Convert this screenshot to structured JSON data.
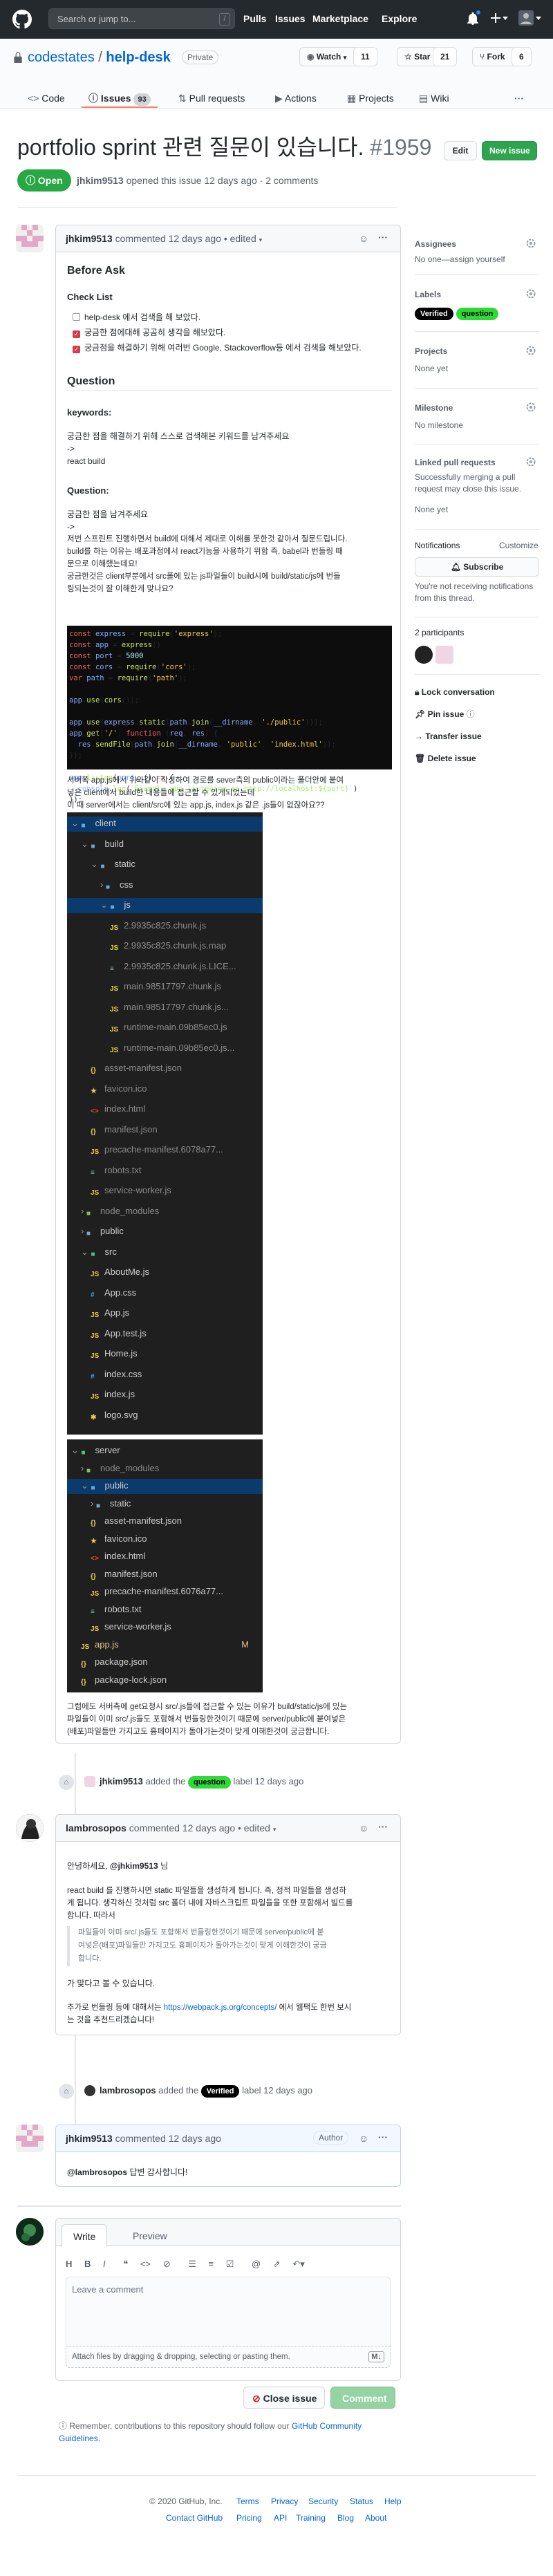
{
  "header": {
    "search_placeholder": "Search or jump to...",
    "slash_key": "/",
    "nav": [
      "Pulls",
      "Issues",
      "Marketplace",
      "Explore"
    ]
  },
  "repo": {
    "owner": "codestates",
    "separator": "/",
    "name": "help-desk",
    "visibility": "Private",
    "watch_label": "Watch",
    "watch_count": "11",
    "star_label": "Star",
    "star_count": "21",
    "fork_label": "Fork",
    "fork_count": "6",
    "tabs": [
      {
        "label": "Code"
      },
      {
        "label": "Issues",
        "count": "93"
      },
      {
        "label": "Pull requests"
      },
      {
        "label": "Actions"
      },
      {
        "label": "Projects"
      },
      {
        "label": "Wiki"
      }
    ]
  },
  "issue": {
    "title": "portfolio sprint 관련 질문이 있습니다.",
    "number": "#1959",
    "edit_label": "Edit",
    "new_issue_label": "New issue",
    "state": "Open",
    "meta_user": "jhkim9513",
    "meta_rest": "opened this issue 12 days ago · 2 comments"
  },
  "comment1": {
    "author": "jhkim9513",
    "meta": "commented 12 days ago • edited",
    "h_before_ask": "Before Ask",
    "h_checklist": "Check List",
    "checks": [
      {
        "text": "help-desk 에서 검색을 해 보았다.",
        "checked": false
      },
      {
        "text": "궁금한 점에대해 공곰히 생각을 해보았다.",
        "checked": true
      },
      {
        "text": "궁금점을 해결하기 위해 여러번 Google, Stackoverflow등 에서 검색을 해보았다.",
        "checked": true
      }
    ],
    "h_question": "Question",
    "keywords_label": "keywords:",
    "keywords_desc": "궁금한 점을 해결하기 위해 스스로 검색해본 키워드를 남겨주세요",
    "arrow1": "->",
    "keywords_value": "react build",
    "question_label": "Question:",
    "question_desc": "궁금한 점을 남겨주세요",
    "arrow2": "->",
    "q_p1_l1": "저번 스프린트 진행하면서 build에 대해서 제대로 이해를 못한것 같아서 질문드립니다.",
    "q_p1_l2": "build를 하는 이유는 배포과정에서 react기능을 사용하기 위함 즉, babel과 번들링 때",
    "q_p1_l3": "문으로 이해했는데요!",
    "q_p1_l4": "궁금한것은 client부분에서 src폴에 있는 js파일들이 build시에 build/static/js에 번들",
    "q_p1_l5": "링되는것이 잘 이해한게 맞나요?",
    "code": [
      "const express = require('express');",
      "const app = express()",
      "const port = 5000",
      "const cors = require('cors');",
      "var path = require('path');",
      "",
      "app.use(cors());",
      "",
      "app.use(express.static(path.join(__dirname, './public')));",
      "app.get('/', function (req, res) {",
      "  res.sendFile(path.join(__dirname, 'public', 'index.html'));",
      "});",
      "",
      "app.listen(port, () => {",
      "  console.log(`Example app listening at http://localhost:${port}`)",
      "});"
    ],
    "q_p2_l1": "서버쪽 app.js에서 위와같이 작성하여 경로를 sever측의 public이라는 폴더안에 붙여",
    "q_p2_l2": "넣은 client에서 build한 내용들에 접근할 수 있게되었는데",
    "q_p2_l3": "이 때 server에서는 client/src에 있는 app.js, index.js 같은 .js들이 없잖아요??",
    "tree1": [
      {
        "name": "client",
        "type": "folder-open",
        "depth": 0,
        "sel": true
      },
      {
        "name": "build",
        "type": "folder-open",
        "depth": 1
      },
      {
        "name": "static",
        "type": "folder-open",
        "depth": 2
      },
      {
        "name": "css",
        "type": "folder",
        "depth": 3
      },
      {
        "name": "js",
        "type": "folder-open",
        "depth": 3,
        "sel": true
      },
      {
        "name": "2.9935c825.chunk.js",
        "type": "js",
        "depth": 4,
        "dim": true
      },
      {
        "name": "2.9935c825.chunk.js.map",
        "type": "js",
        "depth": 4,
        "dim": true
      },
      {
        "name": "2.9935c825.chunk.js.LICE...",
        "type": "txt",
        "depth": 4,
        "dim": true
      },
      {
        "name": "main.98517797.chunk.js",
        "type": "js",
        "depth": 4,
        "dim": true
      },
      {
        "name": "main.98517797.chunk.js...",
        "type": "js",
        "depth": 4,
        "dim": true
      },
      {
        "name": "runtime-main.09b85ec0.js",
        "type": "js",
        "depth": 4,
        "dim": true
      },
      {
        "name": "runtime-main.09b85ec0.js...",
        "type": "js",
        "depth": 4,
        "dim": true
      },
      {
        "name": "asset-manifest.json",
        "type": "json",
        "depth": 2,
        "dim": true
      },
      {
        "name": "favicon.ico",
        "type": "star",
        "depth": 2,
        "dim": true
      },
      {
        "name": "index.html",
        "type": "html",
        "depth": 2,
        "dim": true
      },
      {
        "name": "manifest.json",
        "type": "json",
        "depth": 2,
        "dim": true
      },
      {
        "name": "precache-manifest.6078a77...",
        "type": "js",
        "depth": 2,
        "dim": true
      },
      {
        "name": "robots.txt",
        "type": "txt",
        "depth": 2,
        "dim": true
      },
      {
        "name": "service-worker.js",
        "type": "js",
        "depth": 2,
        "dim": true
      },
      {
        "name": "node_modules",
        "type": "folder",
        "depth": 1,
        "dim": true
      },
      {
        "name": "public",
        "type": "folder",
        "depth": 1
      },
      {
        "name": "src",
        "type": "folder-open",
        "depth": 1
      },
      {
        "name": "AboutMe.js",
        "type": "js",
        "depth": 2
      },
      {
        "name": "App.css",
        "type": "css",
        "depth": 2
      },
      {
        "name": "App.js",
        "type": "js",
        "depth": 2
      },
      {
        "name": "App.test.js",
        "type": "js",
        "depth": 2
      },
      {
        "name": "Home.js",
        "type": "js",
        "depth": 2
      },
      {
        "name": "index.css",
        "type": "css",
        "depth": 2
      },
      {
        "name": "index.js",
        "type": "js",
        "depth": 2
      },
      {
        "name": "logo.svg",
        "type": "svg",
        "depth": 2
      }
    ],
    "tree2": [
      {
        "name": "server",
        "type": "folder-open",
        "depth": 0
      },
      {
        "name": "node_modules",
        "type": "folder",
        "depth": 1,
        "dim": true
      },
      {
        "name": "public",
        "type": "folder-open",
        "depth": 1,
        "sel": true
      },
      {
        "name": "static",
        "type": "folder",
        "depth": 2
      },
      {
        "name": "asset-manifest.json",
        "type": "json",
        "depth": 2
      },
      {
        "name": "favicon.ico",
        "type": "star",
        "depth": 2
      },
      {
        "name": "index.html",
        "type": "html",
        "depth": 2
      },
      {
        "name": "manifest.json",
        "type": "json",
        "depth": 2
      },
      {
        "name": "precache-manifest.6076a77...",
        "type": "js",
        "depth": 2
      },
      {
        "name": "robots.txt",
        "type": "txt",
        "depth": 2
      },
      {
        "name": "service-worker.js",
        "type": "js",
        "depth": 2
      },
      {
        "name": "app.js",
        "type": "js",
        "depth": 1,
        "yellow": true,
        "badge": "M"
      },
      {
        "name": "package.json",
        "type": "json",
        "depth": 1
      },
      {
        "name": "package-lock.json",
        "type": "json",
        "depth": 1
      }
    ],
    "q_p3_l1": "그럼에도 서버측에 get요청시 src/.js들에 접근할 수 있는 이유가 build/static/js에 있는",
    "q_p3_l2": "파일들이 이미 src/.js들도 포함해서 번들링한것이기 때문에 server/public에 붙여넣은",
    "q_p3_l3": "(배포)파일들만 가지고도 흉페이지가 돌아가는것이 맞게 이해한것이 궁금합니다."
  },
  "event1": {
    "user": "jhkim9513",
    "pre": "added the",
    "label": "question",
    "post": "label 12 days ago"
  },
  "comment2": {
    "author": "lambrosopos",
    "meta": "commented 12 days ago • edited",
    "greet_pre": "안녕하세요, ",
    "greet_mention": "@jhkim9513",
    "greet_post": " 님",
    "p1_l1": "react build 를 진행하시면 static 파일들을 생성하게 됩니다. 즉, 정적 파일들을 생성하",
    "p1_l2": "게 됩니다. 생각하신 것처럼 src 폴더 내에 자바스크립트 파일들을 또한 포함해서 빌드를",
    "p1_l3": "합니다. 따라서",
    "quote_l1": "파일들이 이미 src/.js들도 포함해서 번들링한것이기 때문에 server/public에 붙",
    "quote_l2": "여넣은(배포)파일들만 가지고도 흉페이지가 돌아가는것이 맞게 이해한것이 궁금",
    "quote_l3": "합니다.",
    "p2": "가 맞다고 볼 수 있습니다.",
    "p3_pre": "추가로 번들링 등에 대해서는 ",
    "p3_link": "https://webpack.js.org/concepts/",
    "p3_post": " 에서 웹팩도 한번 보시",
    "p3_l2": "는 것을 추천드리겠습니다!"
  },
  "event2": {
    "user": "lambrosopos",
    "pre": "added the",
    "label": "Verified",
    "post": "label 12 days ago"
  },
  "comment3": {
    "author": "jhkim9513",
    "meta": "commented 12 days ago",
    "badge": "Author",
    "mention": "@lambrosopos",
    "text": " 답변 감사합니다!"
  },
  "new_comment": {
    "write_tab": "Write",
    "preview_tab": "Preview",
    "placeholder": "Leave a comment",
    "attach_text": "Attach files by dragging & dropping, selecting or pasting them.",
    "close_label": "Close issue",
    "comment_label": "Comment",
    "guidelines_pre": "Remember, contributions to this repository should follow our ",
    "guidelines_link": "GitHub Community Guidelines",
    "guidelines_post": "."
  },
  "sidebar": {
    "assignees_h": "Assignees",
    "assignees_v": "No one—assign yourself",
    "labels_h": "Labels",
    "labels": [
      "Verified",
      "question"
    ],
    "projects_h": "Projects",
    "projects_v": "None yet",
    "milestone_h": "Milestone",
    "milestone_v": "No milestone",
    "linked_h": "Linked pull requests",
    "linked_v1": "Successfully merging a pull",
    "linked_v2": "request may close this issue.",
    "linked_v3": "None yet",
    "notif_h": "Notifications",
    "customize": "Customize",
    "subscribe": "Subscribe",
    "notif_v1": "You're not receiving notifications",
    "notif_v2": "from this thread.",
    "participants_h": "2 participants",
    "lock": "Lock conversation",
    "pin": "Pin issue",
    "transfer": "Transfer issue",
    "delete": "Delete issue"
  },
  "footer": {
    "copyright": "© 2020 GitHub, Inc.",
    "row1": [
      "Terms",
      "Privacy",
      "Security",
      "Status",
      "Help"
    ],
    "row2": [
      "Contact GitHub",
      "Pricing",
      "API",
      "Training",
      "Blog",
      "About"
    ]
  },
  "colors": {
    "open_green": "#28a745",
    "link_blue": "#0366d6",
    "header_bg": "#24292e",
    "label_question": "#2cdb36",
    "label_verified": "#000000"
  }
}
